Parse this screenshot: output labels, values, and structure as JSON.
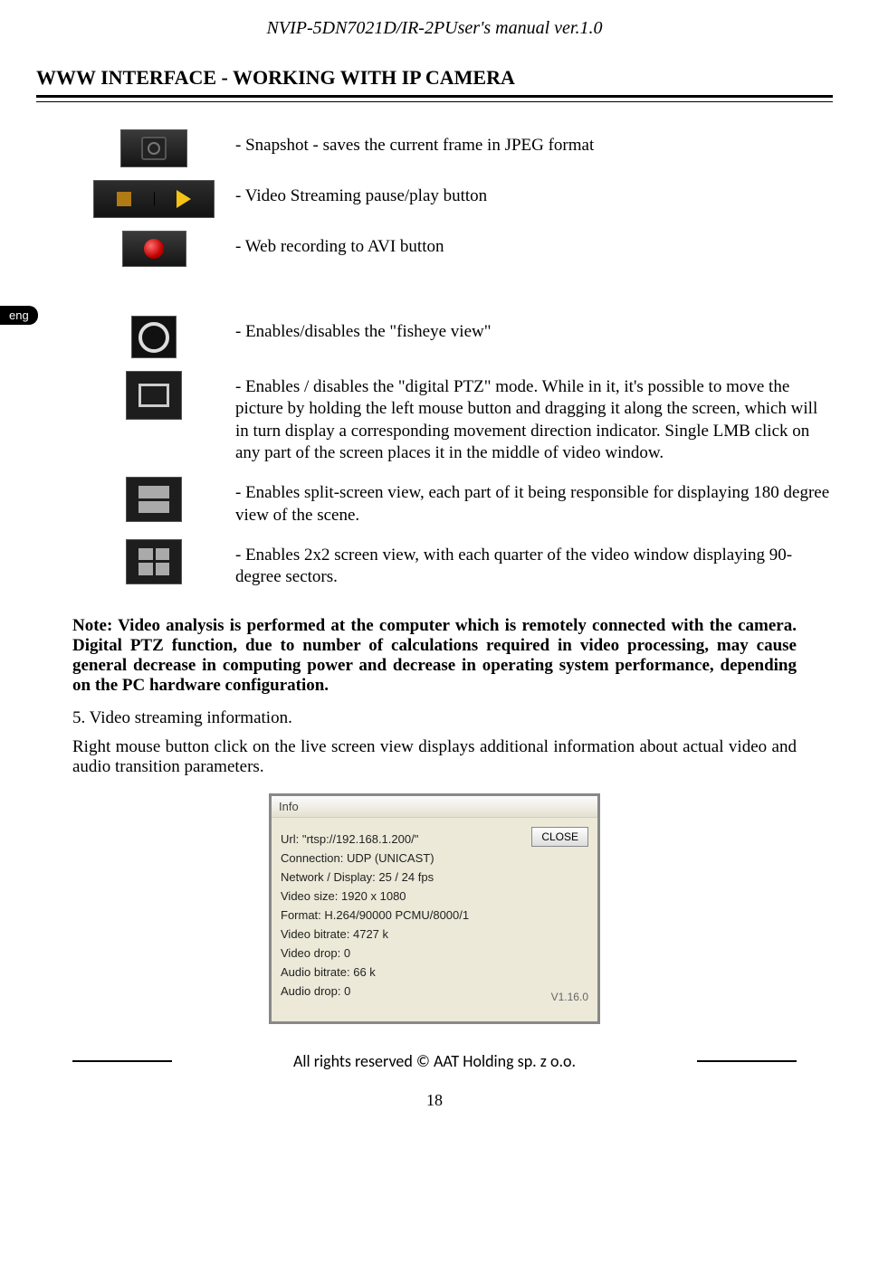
{
  "header": "NVIP-5DN7021D/IR-2PUser's manual ver.1.0",
  "section_title": "WWW INTERFACE - WORKING WITH IP CAMERA",
  "lang_tab": "eng",
  "icons": {
    "snapshot": "- Snapshot - saves the current frame in JPEG format",
    "pauseplay": "- Video Streaming pause/play button",
    "record": "- Web recording to AVI button",
    "fisheye": "- Enables/disables the \"fisheye view\"",
    "ptz": " - Enables / disables the \"digital PTZ\" mode. While in it, it's possible to move the picture by holding the left mouse button and dragging it along the screen, which will in turn display a corresponding movement direction indicator. Single LMB click on any part of the screen places it in the middle of video window.",
    "split": " - Enables split-screen view, each part of it being responsible for displaying 180 degree view of the scene.",
    "quad": " - Enables 2x2 screen view, with each quarter of the video window displaying 90-degree sectors."
  },
  "note": "Note: Video analysis is performed at the computer which is remotely connected with the camera. Digital PTZ function, due to number of calculations required in video processing, may cause general decrease in computing power and decrease in operating system performance, depending on the PC hardware configuration.",
  "step5": "5.  Video streaming information.",
  "para": "Right mouse button click on the live screen view displays additional information about actual video and audio transition parameters.",
  "info": {
    "title": "Info",
    "lines": [
      "Url: \"rtsp://192.168.1.200/\"",
      "Connection: UDP (UNICAST)",
      "Network / Display:  25 / 24 fps",
      "Video size: 1920 x 1080",
      "Format: H.264/90000 PCMU/8000/1",
      "Video bitrate: 4727 k",
      "Video drop: 0",
      "Audio bitrate: 66 k",
      "Audio drop: 0"
    ],
    "close": "CLOSE",
    "version": "V1.16.0"
  },
  "footer": "All rights reserved © AAT Holding sp. z o.o.",
  "page_number": "18"
}
